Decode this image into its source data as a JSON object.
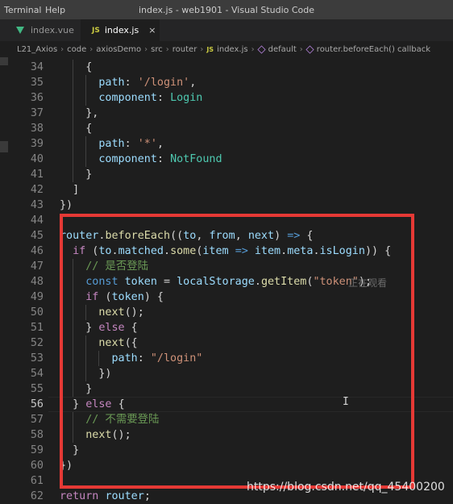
{
  "titlebar": {
    "menu": [
      "Terminal",
      "Help"
    ],
    "title": "index.js - web1901 - Visual Studio Code"
  },
  "tabs": [
    {
      "label": "index.vue",
      "icon": "vue-icon",
      "active": false
    },
    {
      "label": "index.js",
      "icon": "js-icon",
      "active": true,
      "close": "×"
    }
  ],
  "breadcrumb": {
    "parts": [
      "L21_Axios",
      "code",
      "axiosDemo",
      "src",
      "router"
    ],
    "file_badge": "JS",
    "file": "index.js",
    "symbol1": "default",
    "symbol2": "router.beforeEach() callback",
    "separator": "›"
  },
  "editor": {
    "current_line": 56,
    "lines": [
      {
        "n": "34",
        "segs": [
          [
            "    {",
            "op"
          ]
        ]
      },
      {
        "n": "35",
        "segs": [
          [
            "      ",
            "op"
          ],
          [
            "path",
            "key"
          ],
          [
            ": ",
            "op"
          ],
          [
            "'/login'",
            "str"
          ],
          [
            ",",
            "op"
          ]
        ]
      },
      {
        "n": "36",
        "segs": [
          [
            "      ",
            "op"
          ],
          [
            "component",
            "key"
          ],
          [
            ": ",
            "op"
          ],
          [
            "Login",
            "cls"
          ]
        ]
      },
      {
        "n": "37",
        "segs": [
          [
            "    },",
            "op"
          ]
        ]
      },
      {
        "n": "38",
        "segs": [
          [
            "    {",
            "op"
          ]
        ]
      },
      {
        "n": "39",
        "segs": [
          [
            "      ",
            "op"
          ],
          [
            "path",
            "key"
          ],
          [
            ": ",
            "op"
          ],
          [
            "'*'",
            "str"
          ],
          [
            ",",
            "op"
          ]
        ]
      },
      {
        "n": "40",
        "segs": [
          [
            "      ",
            "op"
          ],
          [
            "component",
            "key"
          ],
          [
            ": ",
            "op"
          ],
          [
            "NotFound",
            "cls"
          ]
        ]
      },
      {
        "n": "41",
        "segs": [
          [
            "    }",
            "op"
          ]
        ]
      },
      {
        "n": "42",
        "segs": [
          [
            "  ]",
            "op"
          ]
        ]
      },
      {
        "n": "43",
        "segs": [
          [
            "})",
            "op"
          ]
        ]
      },
      {
        "n": "44",
        "segs": []
      },
      {
        "n": "45",
        "segs": [
          [
            "router",
            "var"
          ],
          [
            ".",
            "op"
          ],
          [
            "beforeEach",
            "fn"
          ],
          [
            "((",
            "op"
          ],
          [
            "to",
            "var"
          ],
          [
            ", ",
            "op"
          ],
          [
            "from",
            "var"
          ],
          [
            ", ",
            "op"
          ],
          [
            "next",
            "var"
          ],
          [
            ") ",
            "op"
          ],
          [
            "=>",
            "kw"
          ],
          [
            " {",
            "op"
          ]
        ]
      },
      {
        "n": "46",
        "segs": [
          [
            "  ",
            "op"
          ],
          [
            "if",
            "ctl"
          ],
          [
            " (",
            "op"
          ],
          [
            "to",
            "var"
          ],
          [
            ".",
            "op"
          ],
          [
            "matched",
            "var"
          ],
          [
            ".",
            "op"
          ],
          [
            "some",
            "fn"
          ],
          [
            "(",
            "op"
          ],
          [
            "item",
            "var"
          ],
          [
            " ",
            "op"
          ],
          [
            "=>",
            "kw"
          ],
          [
            " ",
            "op"
          ],
          [
            "item",
            "var"
          ],
          [
            ".",
            "op"
          ],
          [
            "meta",
            "var"
          ],
          [
            ".",
            "op"
          ],
          [
            "isLogin",
            "var"
          ],
          [
            ")) {",
            "op"
          ]
        ]
      },
      {
        "n": "47",
        "segs": [
          [
            "    ",
            "op"
          ],
          [
            "// 是否登陆",
            "cmt"
          ]
        ]
      },
      {
        "n": "48",
        "segs": [
          [
            "    ",
            "op"
          ],
          [
            "const",
            "kw"
          ],
          [
            " ",
            "op"
          ],
          [
            "token",
            "var"
          ],
          [
            " = ",
            "op"
          ],
          [
            "localStorage",
            "var"
          ],
          [
            ".",
            "op"
          ],
          [
            "getItem",
            "fn"
          ],
          [
            "(",
            "op"
          ],
          [
            "\"token\"",
            "str"
          ],
          [
            ");",
            "op"
          ]
        ]
      },
      {
        "n": "49",
        "segs": [
          [
            "    ",
            "op"
          ],
          [
            "if",
            "ctl"
          ],
          [
            " (",
            "op"
          ],
          [
            "token",
            "var"
          ],
          [
            ") {",
            "op"
          ]
        ]
      },
      {
        "n": "50",
        "segs": [
          [
            "      ",
            "op"
          ],
          [
            "next",
            "fn"
          ],
          [
            "();",
            "op"
          ]
        ]
      },
      {
        "n": "51",
        "segs": [
          [
            "    } ",
            "op"
          ],
          [
            "else",
            "ctl"
          ],
          [
            " {",
            "op"
          ]
        ]
      },
      {
        "n": "52",
        "segs": [
          [
            "      ",
            "op"
          ],
          [
            "next",
            "fn"
          ],
          [
            "({",
            "op"
          ]
        ]
      },
      {
        "n": "53",
        "segs": [
          [
            "        ",
            "op"
          ],
          [
            "path",
            "key"
          ],
          [
            ": ",
            "op"
          ],
          [
            "\"/login\"",
            "str"
          ]
        ]
      },
      {
        "n": "54",
        "segs": [
          [
            "      })",
            "op"
          ]
        ]
      },
      {
        "n": "55",
        "segs": [
          [
            "    }",
            "op"
          ]
        ]
      },
      {
        "n": "56",
        "segs": [
          [
            "  } ",
            "op"
          ],
          [
            "else",
            "ctl"
          ],
          [
            " ",
            "op"
          ],
          [
            "{",
            "op"
          ]
        ]
      },
      {
        "n": "57",
        "segs": [
          [
            "    ",
            "op"
          ],
          [
            "// 不需要登陆",
            "cmt"
          ]
        ]
      },
      {
        "n": "58",
        "segs": [
          [
            "    ",
            "op"
          ],
          [
            "next",
            "fn"
          ],
          [
            "();",
            "op"
          ]
        ]
      },
      {
        "n": "59",
        "segs": [
          [
            "  }",
            "op"
          ]
        ]
      },
      {
        "n": "60",
        "segs": [
          [
            "})",
            "op"
          ]
        ]
      },
      {
        "n": "61",
        "segs": []
      },
      {
        "n": "62",
        "segs": [
          [
            "return",
            "ctl"
          ],
          [
            " ",
            "op"
          ],
          [
            "router",
            "var"
          ],
          [
            ";",
            "op"
          ]
        ]
      }
    ]
  },
  "overlay_text": "正在观看",
  "watermark": "https://blog.csdn.net/qq_45400200"
}
